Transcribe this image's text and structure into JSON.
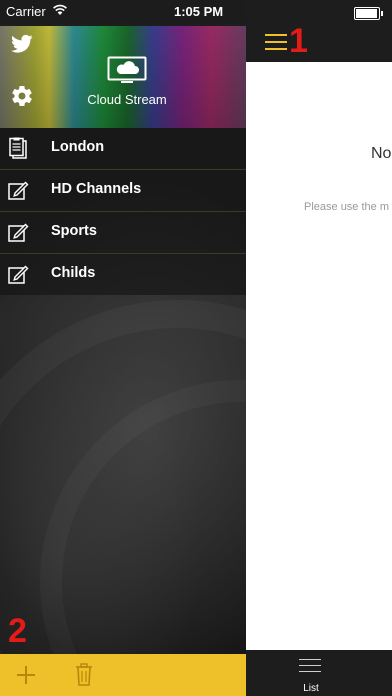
{
  "status_bar": {
    "carrier": "Carrier",
    "time": "1:05 PM",
    "battery_level": 0.95
  },
  "drawer": {
    "brand": "Cloud Stream",
    "menu_items": [
      {
        "label": "London",
        "icon": "clipboard-icon"
      },
      {
        "label": "HD Channels",
        "icon": "edit-icon"
      },
      {
        "label": "Sports",
        "icon": "edit-icon"
      },
      {
        "label": "Childs",
        "icon": "edit-icon"
      }
    ],
    "bottom_bar": {
      "add_icon": "plus-icon",
      "delete_icon": "trash-icon"
    }
  },
  "annotations": {
    "one": "1",
    "two": "2"
  },
  "content": {
    "empty_title": "No",
    "empty_hint": "Please use the m"
  },
  "tabbar": {
    "list_label": "List"
  },
  "colors": {
    "accent": "#eec12a",
    "annotation": "#e41b17",
    "bar": "#1d1d1d"
  }
}
